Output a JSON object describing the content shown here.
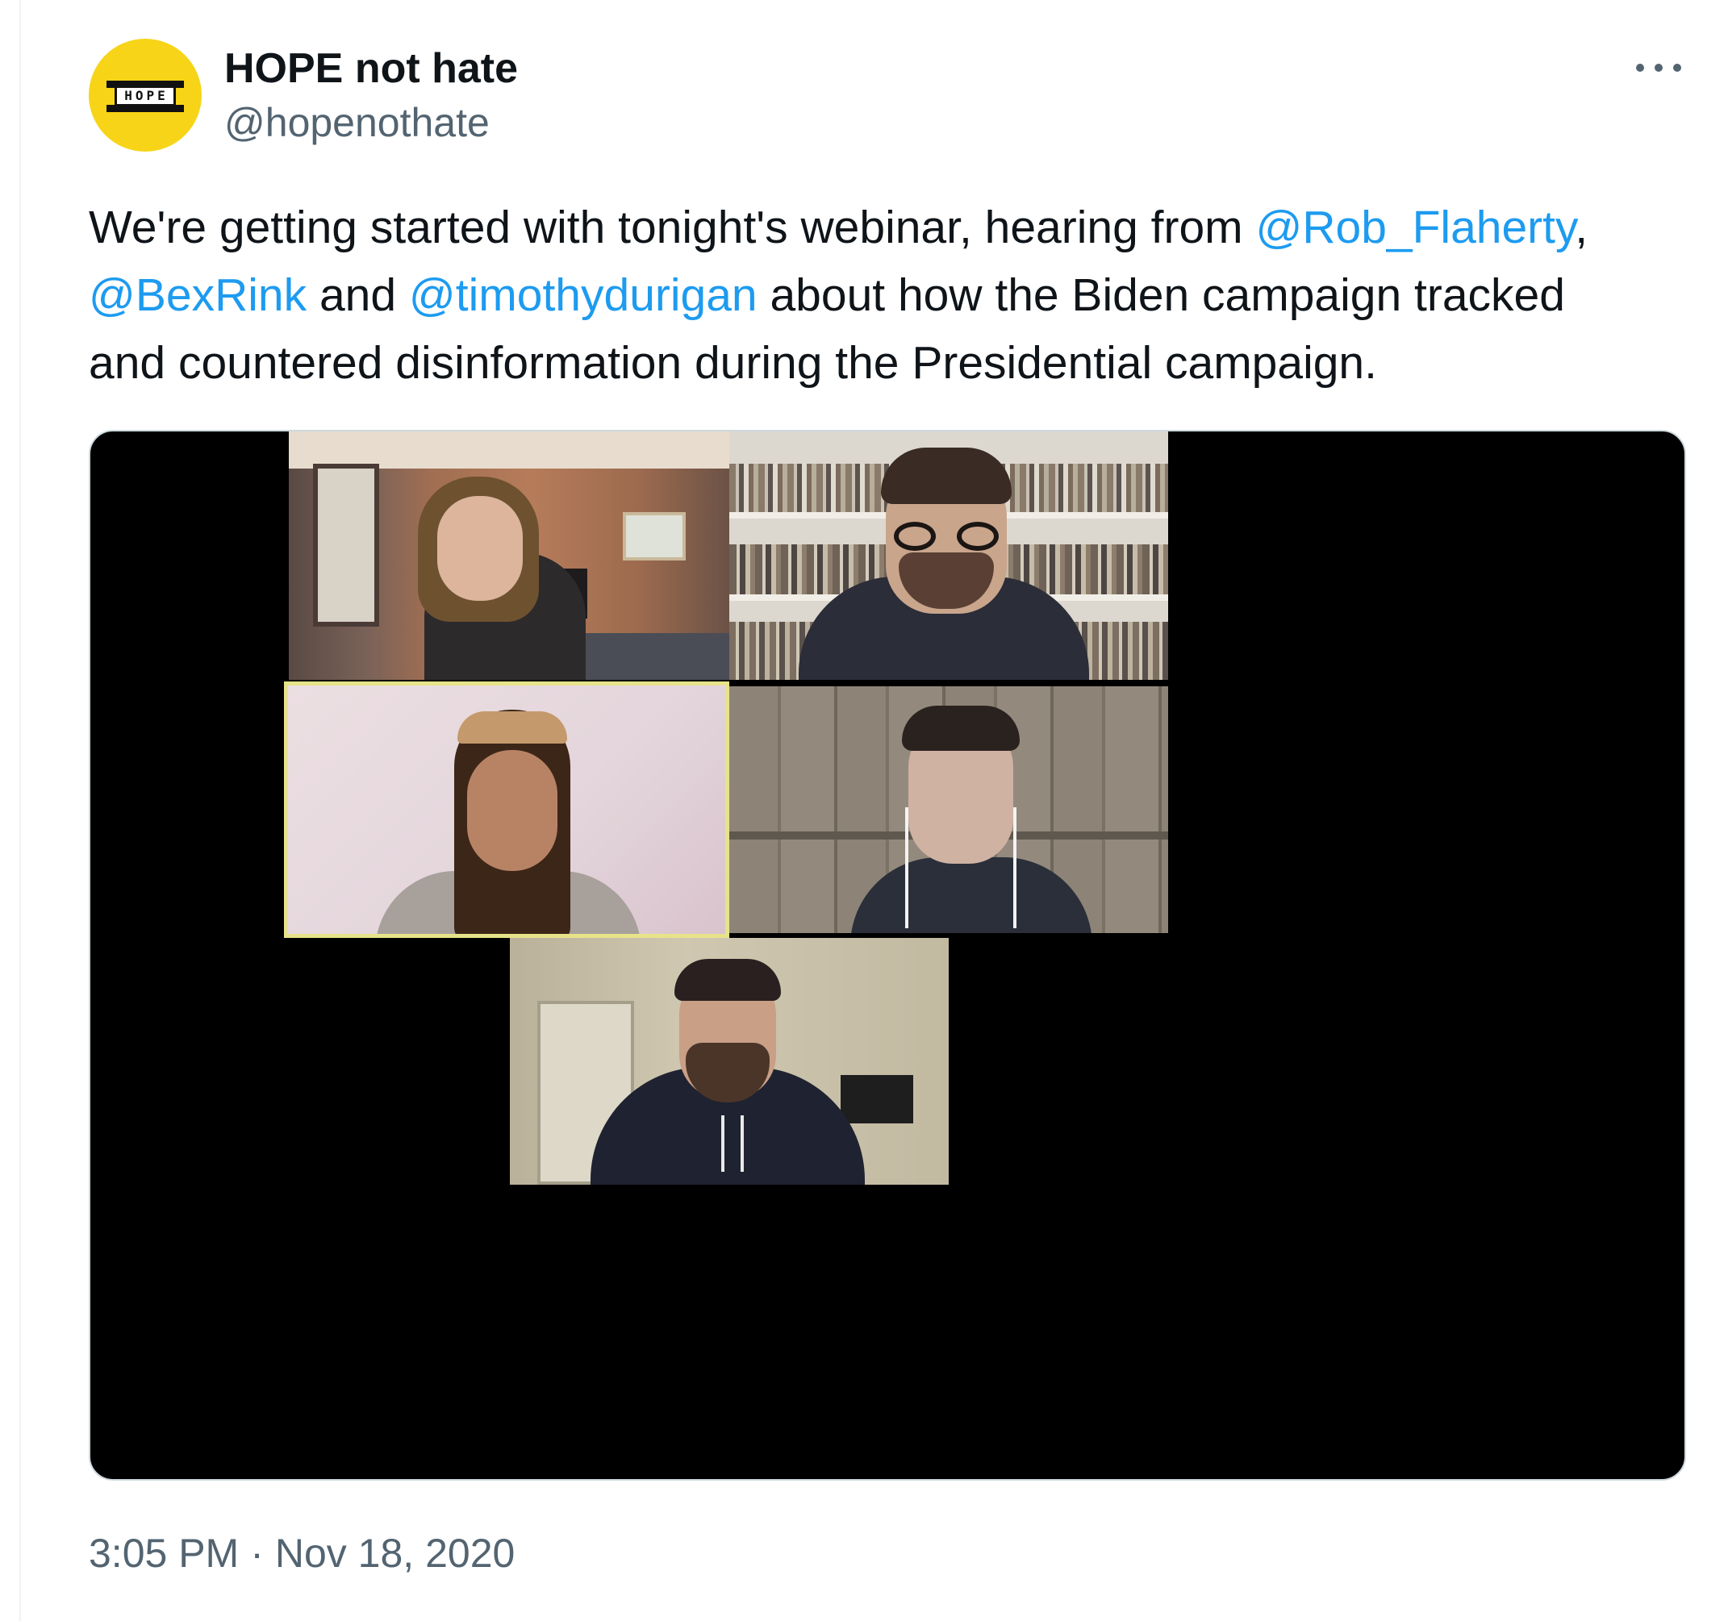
{
  "account": {
    "display_name": "HOPE not hate",
    "handle": "@hopenothate",
    "avatar_logo_text": "HOPE"
  },
  "tweet": {
    "text_part1": "We're getting started with tonight's webinar, hearing from ",
    "mention1": "@Rob_Flaherty",
    "text_comma": ",",
    "mention2": "@BexRink",
    "text_and": " and ",
    "mention3": "@timothydurigan",
    "text_part2": " about how the Biden campaign tracked",
    "text_part3": "and countered disinformation during the Presidential campaign."
  },
  "media": {
    "type": "video-call-screenshot",
    "participants": 5,
    "active_speaker_border_color": "#e6e38a"
  },
  "footer": {
    "time": "3:05 PM",
    "separator": "·",
    "date": "Nov 18, 2020"
  },
  "colors": {
    "accent": "#1d9bf0",
    "text": "#0f1419",
    "secondary_text": "#536471",
    "avatar_bg": "#f7d417"
  }
}
